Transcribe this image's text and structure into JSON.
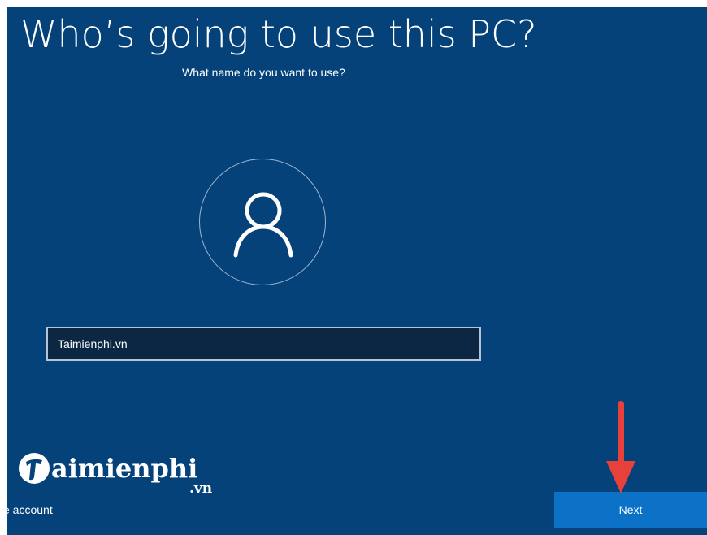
{
  "header": {
    "title": "Who’s going to use this PC?",
    "subtitle": "What name do you want to use?"
  },
  "avatar": {
    "icon": "user-icon"
  },
  "name_field": {
    "value": "Taimienphi.vn"
  },
  "watermark": {
    "brand": "aimienphi",
    "brand_initial": "T",
    "tld": ".vn"
  },
  "footer": {
    "account_link": "e account",
    "next_label": "Next"
  },
  "annotation": {
    "icon": "arrow-down-icon",
    "color": "#e8403a"
  },
  "colors": {
    "background": "#05427a",
    "next_button": "#0b72c8",
    "input_background": "#0b2744"
  }
}
